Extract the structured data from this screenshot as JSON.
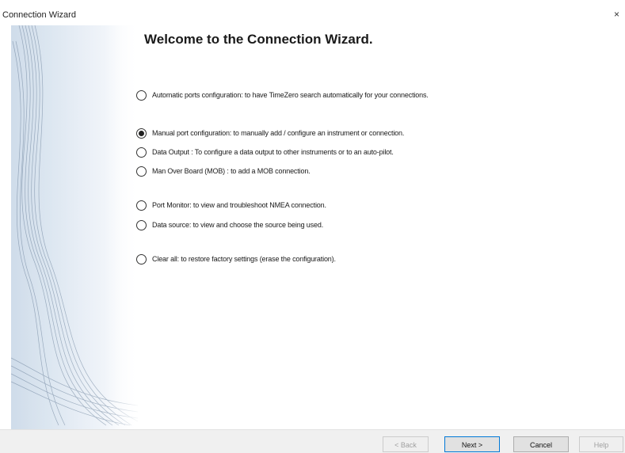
{
  "window": {
    "title": "Connection Wizard",
    "close_glyph": "×"
  },
  "heading": "Welcome to the Connection Wizard.",
  "options": [
    {
      "label": "Automatic ports configuration: to have TimeZero search automatically for your connections.",
      "checked": false
    },
    {
      "label": "Manual port configuration: to manually add / configure an instrument or connection.",
      "checked": true
    },
    {
      "label": "Data Output : To configure a data output to other instruments or to an auto-pilot.",
      "checked": false
    },
    {
      "label": "Man Over Board (MOB) : to add a MOB connection.",
      "checked": false
    },
    {
      "label": "Port Monitor: to view and troubleshoot NMEA connection.",
      "checked": false
    },
    {
      "label": "Data source: to view and choose the source being used.",
      "checked": false
    },
    {
      "label": "Clear all: to restore factory settings (erase the configuration).",
      "checked": false
    }
  ],
  "buttons": {
    "back": {
      "label": "< Back",
      "enabled": false
    },
    "next": {
      "label": "Next >",
      "enabled": true
    },
    "cancel": {
      "label": "Cancel",
      "enabled": true
    },
    "help": {
      "label": "Help",
      "enabled": false
    }
  }
}
